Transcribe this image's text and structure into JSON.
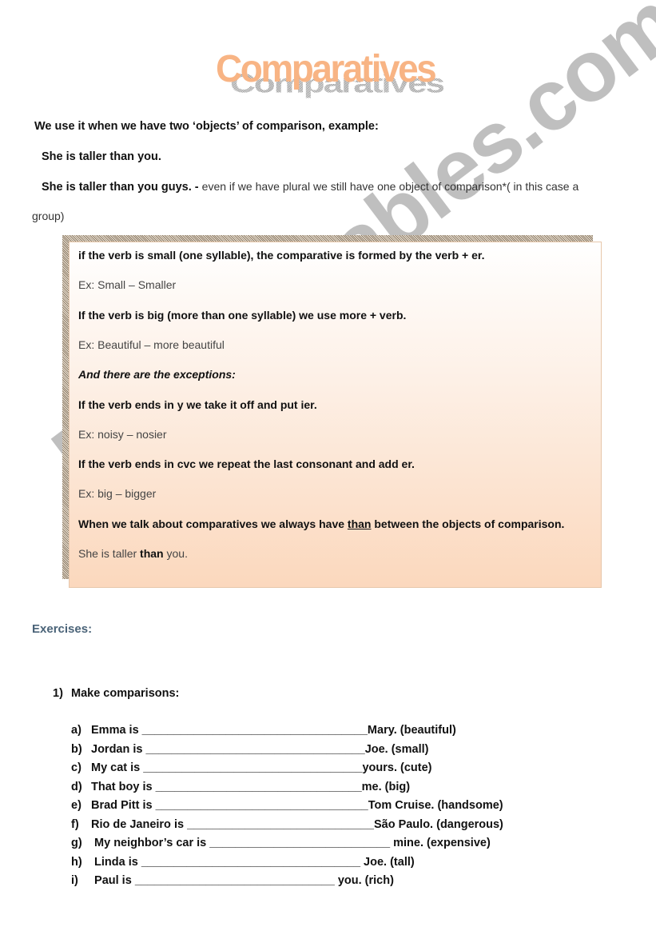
{
  "title": "Comparatives",
  "intro": "We use it when we have two ‘objects’ of comparison, example:",
  "examples": [
    {
      "subject": "She",
      "middle": " is taller than ",
      "object": "you",
      "end": ".",
      "note": ""
    },
    {
      "subject": "She",
      "middle": " is taller than ",
      "object": "you guys",
      "end": ".",
      "dash": " - ",
      "note": "even if we have plural we still have one object of comparison*( in this case a"
    }
  ],
  "group_continuation": "group)",
  "rules": {
    "r1": "if the verb is small (one syllable), the comparative is formed by the verb + er.",
    "e1": "Ex: Small – Smaller",
    "r2": "If the verb is big (more than one syllable) we use more + verb.",
    "e2": "Ex: Beautiful – more beautiful",
    "exceptions": "And there are the exceptions:",
    "r3": "If the verb ends in y we take it off and put ier.",
    "e3": "Ex: noisy – nosier",
    "r4": "If the verb ends in cvc we repeat the last consonant and add er.",
    "e4": "Ex: big – bigger",
    "r5_pre": "When we talk about comparatives we always have ",
    "r5_than": "than",
    "r5_post": " between the objects of comparison.",
    "e5_pre": "She is taller ",
    "e5_than": "than",
    "e5_post": " you."
  },
  "exercises_heading": "Exercises:",
  "task": {
    "number": "1)",
    "label": "Make comparisons:"
  },
  "items": [
    {
      "letter": "a)",
      "start": "Emma is ",
      "blank": "___________________________________",
      "end": "Mary. (beautiful)"
    },
    {
      "letter": "b)",
      "start": "Jordan is ",
      "blank": "__________________________________",
      "end": "Joe. (small)"
    },
    {
      "letter": "c)",
      "start": "My cat is ",
      "blank": "__________________________________",
      "end": "yours. (cute)"
    },
    {
      "letter": "d)",
      "start": "That boy is ",
      "blank": "________________________________",
      "end": "me. (big)"
    },
    {
      "letter": "e)",
      "start": "Brad Pitt is ",
      "blank": "_________________________________",
      "end": "Tom Cruise. (handsome)"
    },
    {
      "letter": "f)",
      "start": "Rio de Janeiro is ",
      "blank": "_____________________________",
      "end": "São Paulo. (dangerous)"
    },
    {
      "letter": "g)",
      "start": " My neighbor’s car is ",
      "blank": "____________________________",
      "end": " mine. (expensive)"
    },
    {
      "letter": "h)",
      "start": " Linda is ",
      "blank": "__________________________________",
      "end": " Joe. (tall)"
    },
    {
      "letter": "i)",
      "start": " Paul is ",
      "blank": "_______________________________",
      "end": " you. (rich)"
    }
  ],
  "watermark": "ESLprintables.com",
  "colors": {
    "title": "#f8b484",
    "heading": "#4a6378",
    "box_bottom": "#fbd8bd"
  }
}
